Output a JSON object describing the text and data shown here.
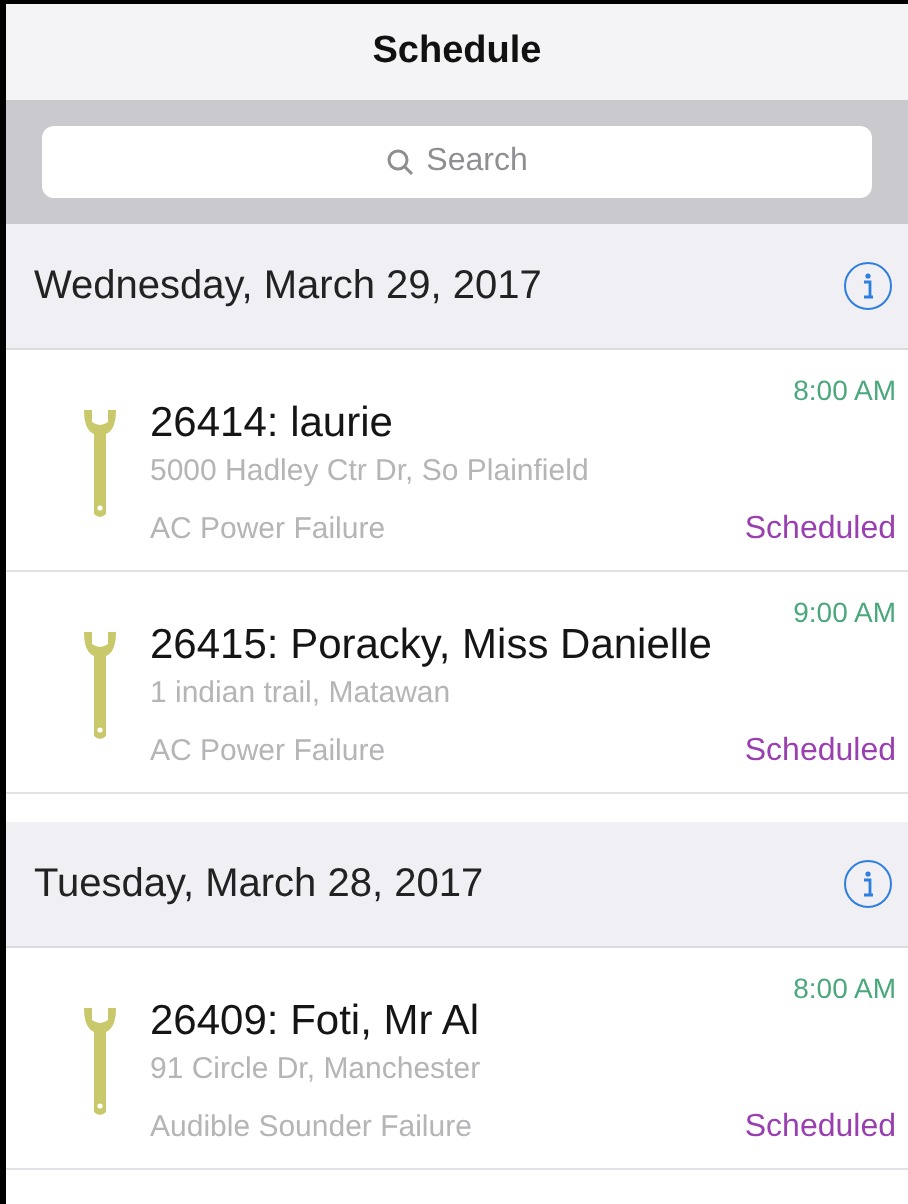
{
  "title": "Schedule",
  "search": {
    "placeholder": "Search"
  },
  "sections": [
    {
      "date": "Wednesday, March 29, 2017",
      "jobs": [
        {
          "title": "26414: laurie",
          "time": "8:00 AM",
          "address": "5000 Hadley Ctr Dr, So Plainfield",
          "problem": "AC Power Failure",
          "status": "Scheduled"
        },
        {
          "title": "26415: Poracky, Miss Danielle",
          "time": "9:00 AM",
          "address": "1 indian trail, Matawan",
          "problem": "AC Power Failure",
          "status": "Scheduled"
        }
      ]
    },
    {
      "date": "Tuesday, March 28, 2017",
      "jobs": [
        {
          "title": "26409: Foti, Mr Al",
          "time": "8:00 AM",
          "address": "91 Circle Dr, Manchester",
          "problem": "Audible Sounder Failure",
          "status": "Scheduled"
        }
      ]
    }
  ]
}
